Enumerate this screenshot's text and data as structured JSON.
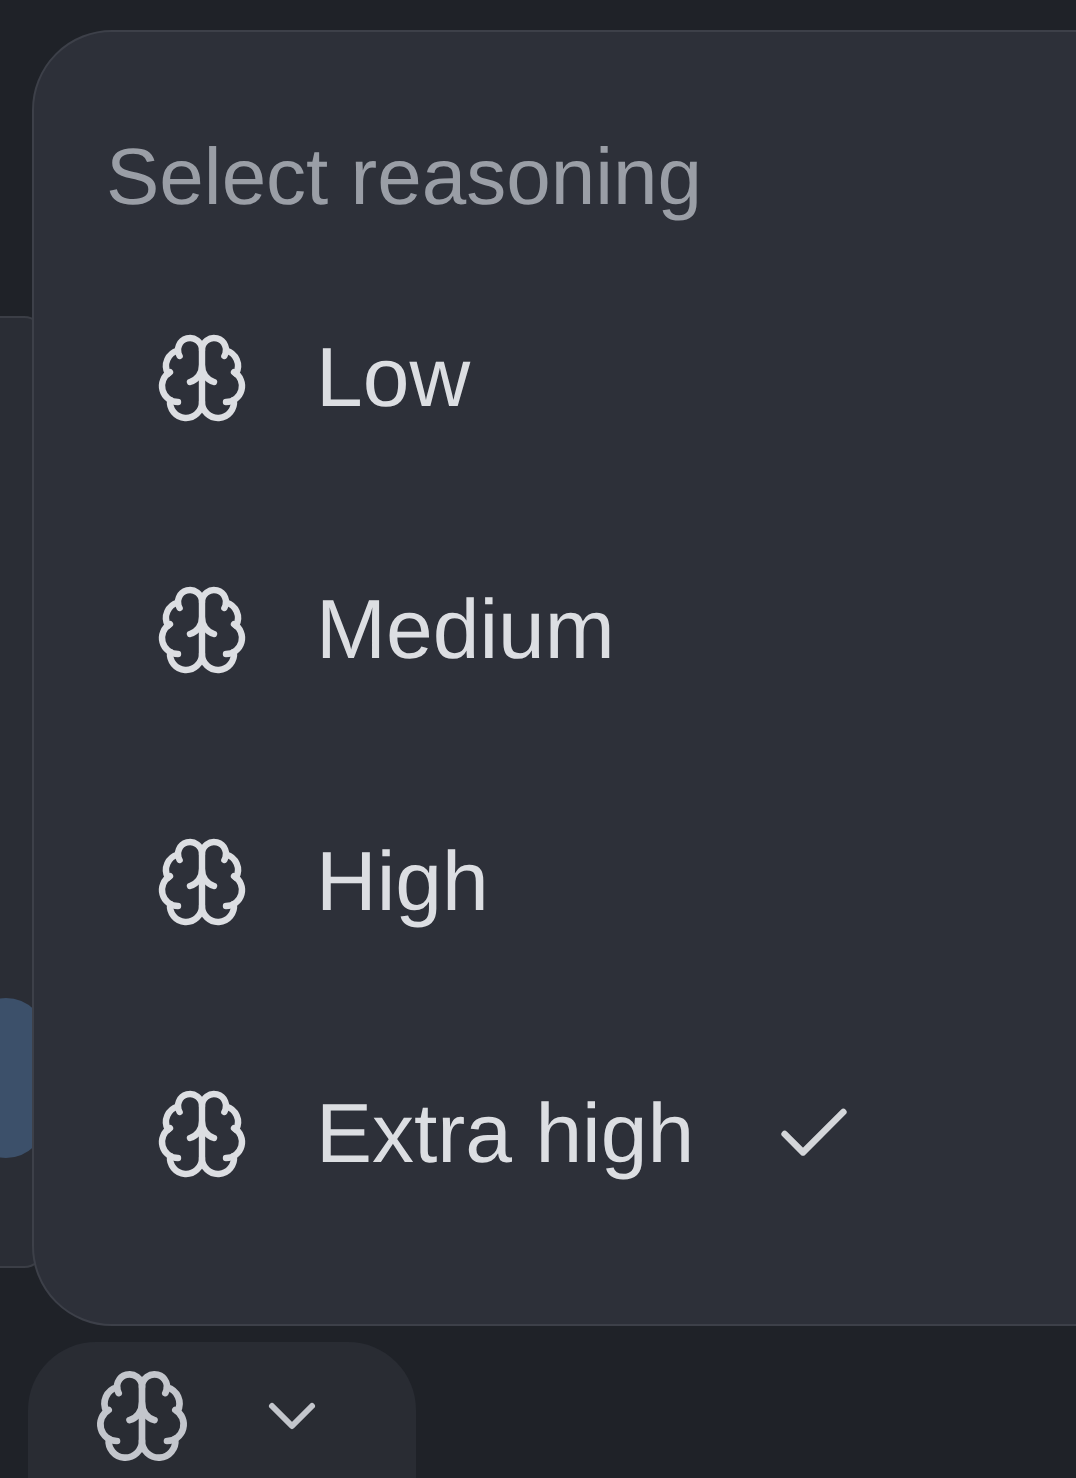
{
  "menu": {
    "title": "Select reasoning",
    "items": [
      {
        "label": "Low",
        "selected": false
      },
      {
        "label": "Medium",
        "selected": false
      },
      {
        "label": "High",
        "selected": false
      },
      {
        "label": "Extra high",
        "selected": true
      }
    ]
  },
  "reasoning_button": {
    "expanded": true
  }
}
